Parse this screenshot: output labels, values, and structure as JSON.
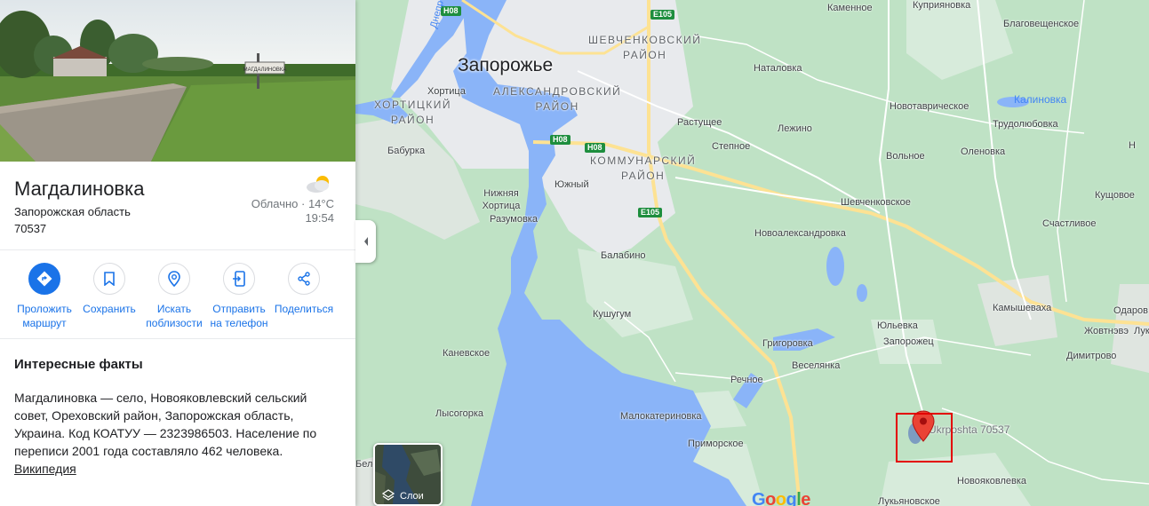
{
  "place": {
    "title": "Магдалиновка",
    "region": "Запорожская область",
    "zip": "70537",
    "hero_sign_text": "МАГДАЛИНОВКА"
  },
  "weather": {
    "condition_temp": "Облачно · 14°C",
    "time": "19:54",
    "icon": "partly-cloudy-icon"
  },
  "actions": [
    {
      "label": "Проложить маршрут",
      "icon": "directions-icon"
    },
    {
      "label": "Сохранить",
      "icon": "bookmark-icon"
    },
    {
      "label": "Искать поблизости",
      "icon": "nearby-icon"
    },
    {
      "label": "Отправить на телефон",
      "icon": "send-to-phone-icon"
    },
    {
      "label": "Поделиться",
      "icon": "share-icon"
    }
  ],
  "facts": {
    "title": "Интересные факты",
    "body": "Магдалиновка — село, Новояковлевский сельский совет, Ореховский район, Запорожская область, Украина. Код КОАТУУ — 2323986503. Население по переписи 2001 года составляло 462 человека.",
    "link": "Википедия"
  },
  "map": {
    "city": "Запорожье",
    "districts": {
      "shevchenkovsky": [
        "ШЕВЧЕНКОВСКИЙ",
        "РАЙОН"
      ],
      "alexandrovsky": [
        "АЛЕКСАНДРОВСКИЙ",
        "РАЙОН"
      ],
      "khortitsky": [
        "ХОРТИЦКИЙ",
        "РАЙОН"
      ],
      "kommunarsky": [
        "КОММУНАРСКИЙ",
        "РАЙОН"
      ]
    },
    "water": {
      "dnepr": "Днепр",
      "kalinovka": "Калиновка"
    },
    "shields": {
      "h08a": "H08",
      "h08b": "H08",
      "h08c": "H08",
      "e105a": "E105",
      "e105b": "E105"
    },
    "places": {
      "kamennoe": "Каменное",
      "kupriyanovka": "Куприяновка",
      "blagoveshchenskoe": "Благовещенское",
      "natalovka": "Наталовка",
      "khortitsa": "Хортица",
      "novotavricheskoe": "Новотаврическое",
      "trudolyubovka": "Трудолюбовка",
      "rastushchee": "Растущее",
      "lezhino": "Лежино",
      "baburka": "Бабурка",
      "stepnoe": "Степное",
      "volnoe": "Вольное",
      "olenovka": "Оленовка",
      "yuzhny": "Южный",
      "nizhnyaya_khortitsa": "Нижняя Хортица",
      "kushchovoe": "Кущовое",
      "shevchenkovskoe": "Шевченковское",
      "razumovka": "Разумовка",
      "schastlivoe": "Счастливое",
      "novoaleksandrovka": "Новоалександровка",
      "balabino": "Балабино",
      "kamyshevakha": "Камышеваха",
      "kushugum": "Кушугум",
      "odarovka": "Одаров",
      "yulyevka": "Юльевка",
      "zhovtnevoe": "Жовтнэвэ",
      "lu": "Лук",
      "zaporozhets": "Запорожец",
      "grigorovka": "Григоровка",
      "kanevskoe": "Каневское",
      "dimitrovo": "Димитрово",
      "veselyanka": "Веселянка",
      "rechnoe": "Речное",
      "lysogorka": "Лысогорка",
      "malokaterinovka": "Малокатериновка",
      "primorskoe": "Приморское",
      "novoyakovlevka": "Новояковлевка",
      "lukyanovskoe": "Лукьяновское",
      "bel": "Беле"
    },
    "layers_label": "Слои",
    "marker_label": "Ukrposhta 70537",
    "google": [
      "G",
      "o",
      "o",
      "g",
      "l",
      "e"
    ],
    "colors": {
      "land": "#bfe2c5",
      "water": "#8ab4f8",
      "urban": "#e8eaed",
      "highway": "#fde293",
      "road": "#ffffff",
      "pin": "#ea4335",
      "highlight": "#e30000"
    }
  }
}
